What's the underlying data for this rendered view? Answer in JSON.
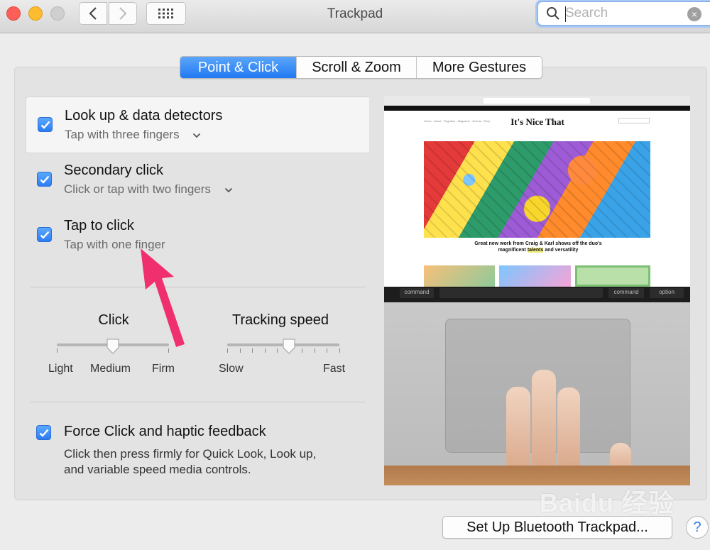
{
  "window": {
    "title": "Trackpad",
    "search_placeholder": "Search",
    "search_value": ""
  },
  "tabs": [
    {
      "label": "Point & Click",
      "active": true
    },
    {
      "label": "Scroll & Zoom",
      "active": false
    },
    {
      "label": "More Gestures",
      "active": false
    }
  ],
  "options": [
    {
      "title": "Look up & data detectors",
      "subtitle": "Tap with three fingers",
      "checked": true,
      "has_dropdown": true,
      "selected": true
    },
    {
      "title": "Secondary click",
      "subtitle": "Click or tap with two fingers",
      "checked": true,
      "has_dropdown": true,
      "selected": false
    },
    {
      "title": "Tap to click",
      "subtitle": "Tap with one finger",
      "checked": true,
      "has_dropdown": false,
      "selected": false
    }
  ],
  "sliders": {
    "click": {
      "label": "Click",
      "min_label": "Light",
      "mid_label": "Medium",
      "max_label": "Firm",
      "value": 0.5
    },
    "tracking": {
      "label": "Tracking speed",
      "min_label": "Slow",
      "max_label": "Fast",
      "value": 0.55
    }
  },
  "force_click": {
    "title": "Force Click and haptic feedback",
    "description_line1": "Click then press firmly for Quick Look, Look up,",
    "description_line2": "and variable speed media controls.",
    "checked": true
  },
  "preview": {
    "site_name": "It's Nice That",
    "caption_line1": "Great new work from Craig & Karl shows off the duo's",
    "caption_line2_pre": "magnificent ",
    "caption_highlight": "talents",
    "caption_line2_post": " and versatility",
    "keys": [
      "command",
      "command",
      "option"
    ]
  },
  "footer": {
    "setup_label": "Set Up Bluetooth Trackpad...",
    "help_label": "?"
  },
  "watermark": "Baidu 经验",
  "colors": {
    "accent": "#2279f2",
    "arrow": "#f0306e"
  }
}
